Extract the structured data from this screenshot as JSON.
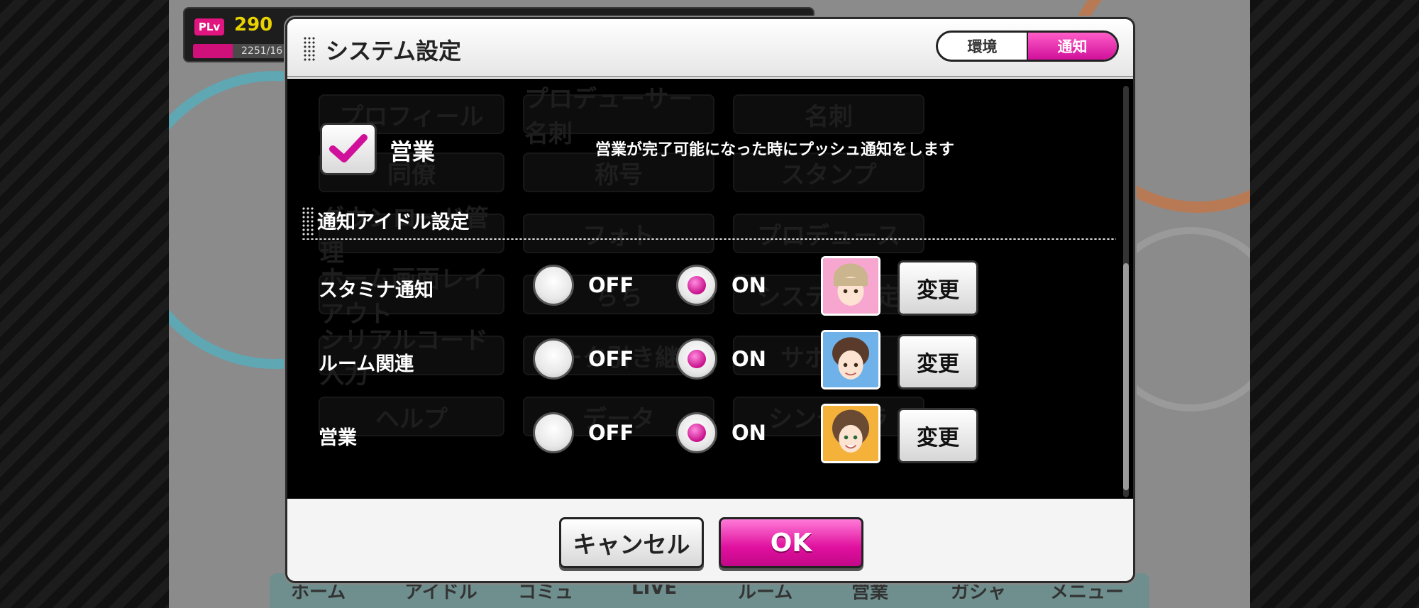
{
  "player": {
    "level_badge": "PLv",
    "level": "290",
    "exp_text": "2251/16",
    "exp_fraction": 0.14
  },
  "background": {
    "tiles": [
      "プロフィール",
      "プロデューサー名刺",
      "名刺",
      "同僚",
      "称号",
      "スタンプ",
      "ダウンロード管理",
      "フォト",
      "プロデュース",
      "ホーム画面レイアウト",
      "ちち",
      "システム設定",
      "シリアルコード入力",
      "データ引き継ぎ",
      "サポート",
      "ヘルプ",
      "データ",
      "シンデレラ"
    ],
    "nav_items": [
      "ホーム",
      "アイドル",
      "コミュ",
      "LIVE",
      "ルーム",
      "営業",
      "ガシャ",
      "メニュー"
    ]
  },
  "modal": {
    "title": "システム設定",
    "tabs": [
      {
        "label": "環境",
        "active": false
      },
      {
        "label": "通知",
        "active": true
      }
    ],
    "push_option": {
      "checked": true,
      "label": "営業",
      "description": "営業が完了可能になった時にプッシュ通知をします"
    },
    "section_title": "通知アイドル設定",
    "rows": [
      {
        "label": "スタミナ通知",
        "off_label": "OFF",
        "on_label": "ON",
        "selected": "ON",
        "change_label": "変更",
        "portrait_color": "#f7a6cf"
      },
      {
        "label": "ルーム関連",
        "off_label": "OFF",
        "on_label": "ON",
        "selected": "ON",
        "change_label": "変更",
        "portrait_color": "#6fb2ea"
      },
      {
        "label": "営業",
        "off_label": "OFF",
        "on_label": "ON",
        "selected": "ON",
        "change_label": "変更",
        "portrait_color": "#f4b23b"
      }
    ],
    "cancel_label": "キャンセル",
    "ok_label": "OK"
  },
  "colors": {
    "accent": "#e0109e",
    "level_text": "#e8d200"
  }
}
